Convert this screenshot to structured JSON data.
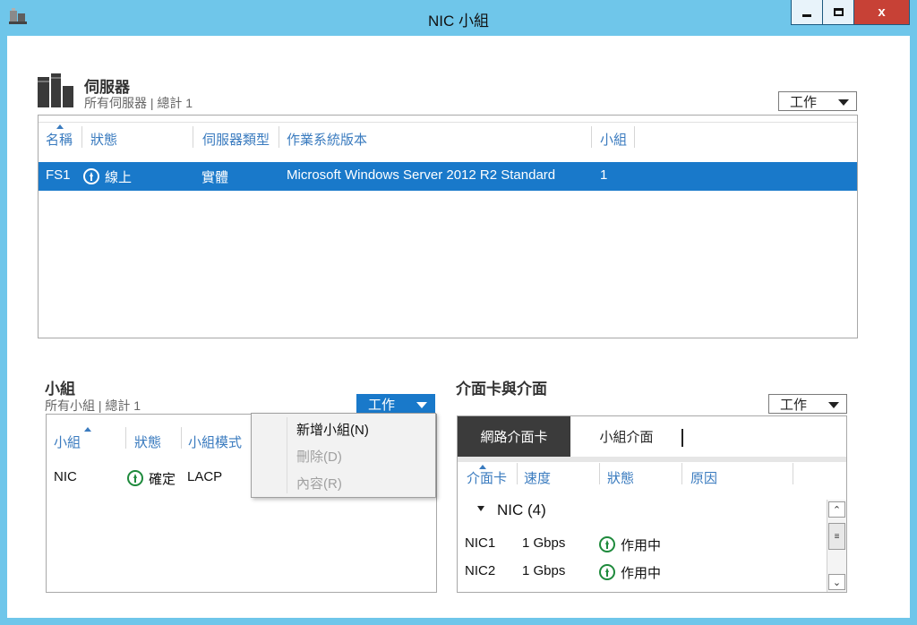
{
  "window": {
    "title": "NIC 小組",
    "minimize": "–",
    "maximize": "□",
    "close": "x"
  },
  "servers": {
    "heading": "伺服器",
    "subtitle": "所有伺服器 | 總計 1",
    "tasks_label": "工作",
    "columns": [
      "名稱",
      "狀態",
      "伺服器類型",
      "作業系統版本",
      "小組"
    ],
    "rows": [
      {
        "name": "FS1",
        "status": "線上",
        "type": "實體",
        "os": "Microsoft Windows Server 2012 R2 Standard",
        "teams": "1"
      }
    ]
  },
  "teams": {
    "heading": "小組",
    "subtitle": "所有小組 | 總計 1",
    "tasks_label": "工作",
    "columns": [
      "小組",
      "狀態",
      "小組模式"
    ],
    "rows": [
      {
        "team": "NIC",
        "status": "確定",
        "mode": "LACP"
      }
    ],
    "menu": [
      {
        "label": "新增小組(N)",
        "enabled": true
      },
      {
        "label": "刪除(D)",
        "enabled": false
      },
      {
        "label": "內容(R)",
        "enabled": false
      }
    ]
  },
  "adapters": {
    "heading": "介面卡與介面",
    "tasks_label": "工作",
    "tabs": [
      "網路介面卡",
      "小組介面"
    ],
    "columns": [
      "介面卡",
      "速度",
      "狀態",
      "原因"
    ],
    "group_label": "NIC (4)",
    "rows": [
      {
        "adapter": "NIC1",
        "speed": "1 Gbps",
        "status": "作用中"
      },
      {
        "adapter": "NIC2",
        "speed": "1 Gbps",
        "status": "作用中"
      }
    ]
  },
  "colors": {
    "titlebar": "#6fc6ea",
    "selection": "#1979ca",
    "close": "#c74136",
    "status_green": "#1e8a3c"
  }
}
